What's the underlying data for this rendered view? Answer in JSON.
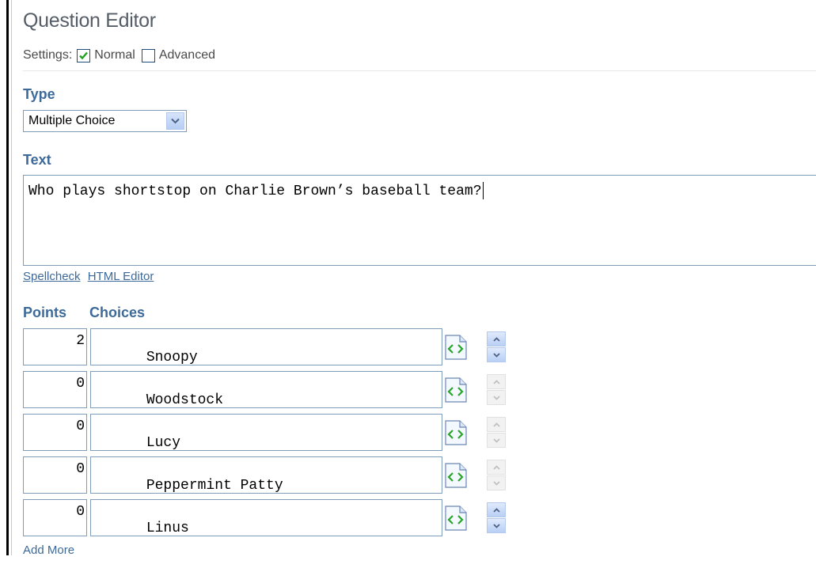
{
  "header": {
    "title": "Question Editor"
  },
  "settings": {
    "label": "Settings:",
    "normal_label": "Normal",
    "normal_checked": true,
    "advanced_label": "Advanced",
    "advanced_checked": false
  },
  "type_section": {
    "label": "Type",
    "selected": "Multiple Choice"
  },
  "text_section": {
    "label": "Text",
    "value": "Who plays shortstop on Charlie Brown’s baseball team?"
  },
  "links": {
    "spellcheck": "Spellcheck",
    "html_editor": "HTML Editor"
  },
  "choices_header": {
    "points": "Points",
    "choices": "Choices"
  },
  "choices": [
    {
      "points": "2",
      "text": "Snoopy",
      "scroll_enabled": true
    },
    {
      "points": "0",
      "text": "Woodstock",
      "scroll_enabled": false
    },
    {
      "points": "0",
      "text": "Lucy",
      "scroll_enabled": false
    },
    {
      "points": "0",
      "text": "Peppermint Patty",
      "scroll_enabled": false
    },
    {
      "points": "0",
      "text": "Linus",
      "scroll_enabled": true
    }
  ],
  "add_more": "Add More",
  "colors": {
    "accent": "#3d6a99",
    "border": "#7f9db9",
    "title": "#555d66",
    "html_icon_green": "#2aa52a"
  }
}
